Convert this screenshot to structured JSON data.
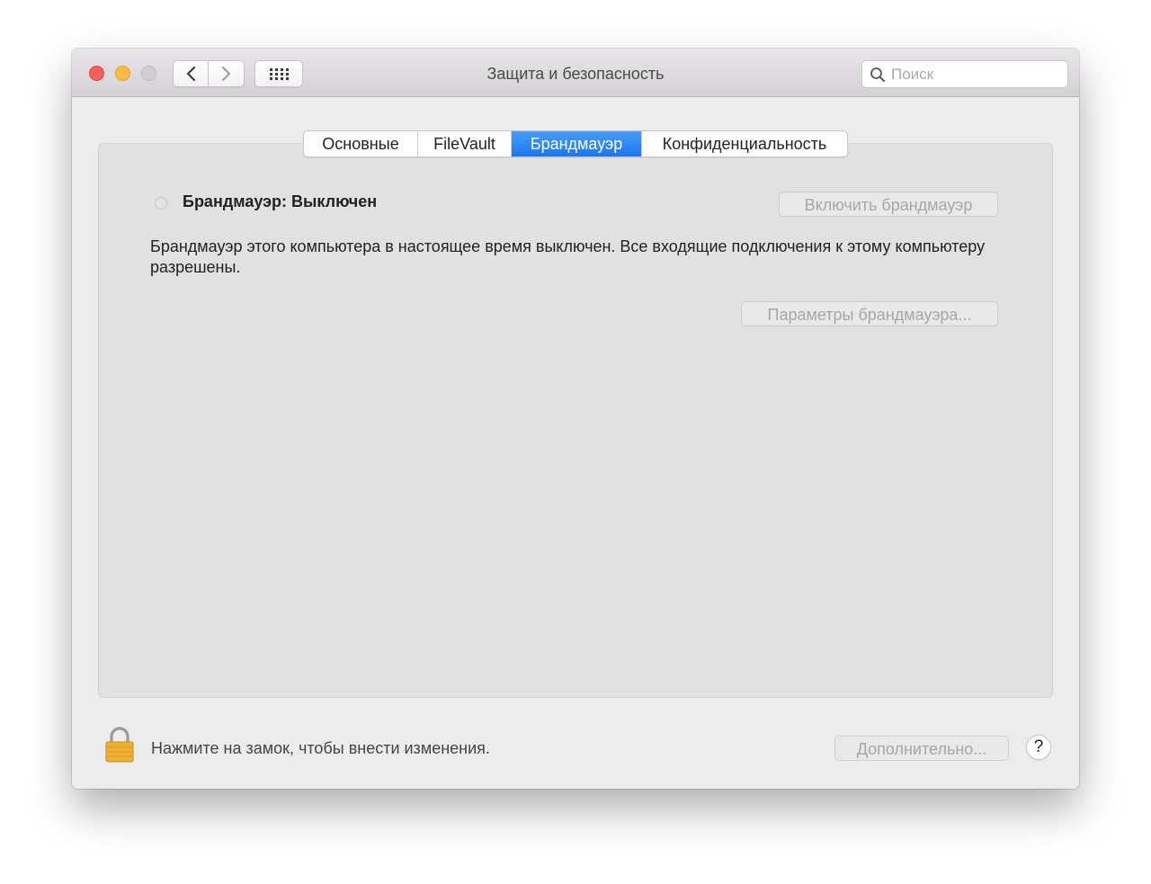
{
  "window": {
    "title": "Защита и безопасность"
  },
  "toolbar": {
    "back_icon": "chevron-left-icon",
    "forward_icon": "chevron-right-icon",
    "grid_icon": "grid-icon"
  },
  "search": {
    "placeholder": "Поиск",
    "value": ""
  },
  "tabs": [
    {
      "label": "Основные",
      "active": false
    },
    {
      "label": "FileVault",
      "active": false
    },
    {
      "label": "Брандмауэр",
      "active": true
    },
    {
      "label": "Конфиденциальность",
      "active": false
    }
  ],
  "firewall": {
    "status_label": "Брандмауэр: Выключен",
    "enable_button": "Включить брандмауэр",
    "description": "Брандмауэр этого компьютера в настоящее время выключен. Все входящие подключения к этому компьютеру разрешены.",
    "options_button": "Параметры брандмауэра..."
  },
  "footer": {
    "lock_text": "Нажмите на замок, чтобы внести изменения.",
    "advanced_button": "Дополнительно...",
    "help_label": "?"
  },
  "colors": {
    "accent": "#1a76f2",
    "close": "#fc605c",
    "minimize": "#fdbc40",
    "lock": "#f0b132"
  }
}
